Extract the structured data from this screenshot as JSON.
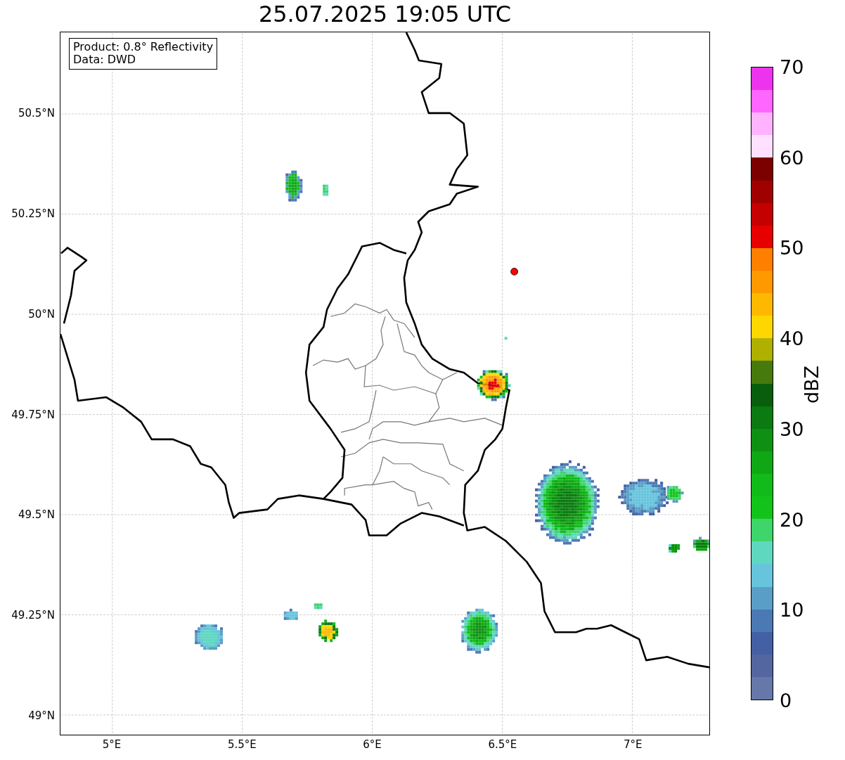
{
  "title": "25.07.2025 19:05 UTC",
  "info_box": {
    "lines": [
      "Product: 0.8° Reflectivity",
      "Data: DWD"
    ]
  },
  "x_ticks": [
    "5°E",
    "5.5°E",
    "6°E",
    "6.5°E",
    "7°E"
  ],
  "y_ticks": [
    "50.5°N",
    "50.25°N",
    "50°N",
    "49.75°N",
    "49.5°N",
    "49.25°N",
    "49°N"
  ],
  "colorbar": {
    "label": "dBZ",
    "ticks": [
      "70",
      "60",
      "50",
      "40",
      "30",
      "20",
      "10",
      "0"
    ],
    "bins": [
      {
        "color": "#ee33ee"
      },
      {
        "color": "#ff66ff"
      },
      {
        "color": "#ffb3ff"
      },
      {
        "color": "#ffe0ff"
      },
      {
        "color": "#7d0000"
      },
      {
        "color": "#a10000"
      },
      {
        "color": "#c40000"
      },
      {
        "color": "#e60000"
      },
      {
        "color": "#ff7f00"
      },
      {
        "color": "#ff9900"
      },
      {
        "color": "#ffb800"
      },
      {
        "color": "#ffd700"
      },
      {
        "color": "#b0b000"
      },
      {
        "color": "#477a0c"
      },
      {
        "color": "#085e0c"
      },
      {
        "color": "#0b7a10"
      },
      {
        "color": "#0e9112"
      },
      {
        "color": "#0fa814"
      },
      {
        "color": "#10bb1a"
      },
      {
        "color": "#12c41a"
      },
      {
        "color": "#3ed56a"
      },
      {
        "color": "#5fd8c0"
      },
      {
        "color": "#66c4dc"
      },
      {
        "color": "#5a9ec6"
      },
      {
        "color": "#4b79b3"
      },
      {
        "color": "#4460a4"
      },
      {
        "color": "#5366a0"
      },
      {
        "color": "#6677aa"
      }
    ]
  }
}
